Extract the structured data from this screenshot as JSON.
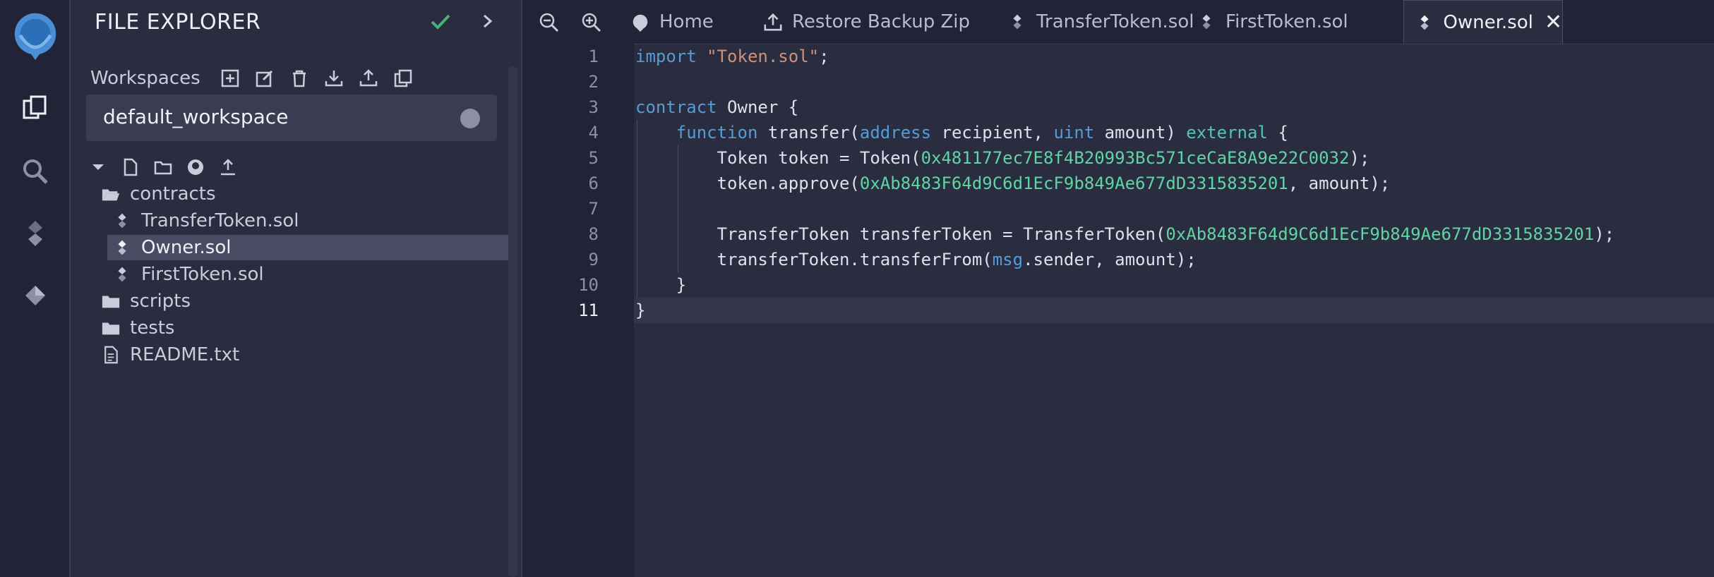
{
  "side_panel": {
    "title": "FILE EXPLORER",
    "workspaces_label": "Workspaces",
    "workspace_selected": "default_workspace",
    "tree": [
      {
        "label": "contracts",
        "type": "folder-open"
      },
      {
        "label": "TransferToken.sol",
        "type": "sol"
      },
      {
        "label": "Owner.sol",
        "type": "sol",
        "selected": true
      },
      {
        "label": "FirstToken.sol",
        "type": "sol"
      },
      {
        "label": "scripts",
        "type": "folder"
      },
      {
        "label": "tests",
        "type": "folder"
      },
      {
        "label": "README.txt",
        "type": "file"
      }
    ]
  },
  "tabs": [
    {
      "label": "Home",
      "icon": "home-icon"
    },
    {
      "label": "Restore Backup Zip",
      "icon": "upload-icon"
    },
    {
      "label": "TransferToken.sol",
      "icon": "solidity-icon"
    },
    {
      "label": "FirstToken.sol",
      "icon": "solidity-icon"
    },
    {
      "label": "Owner.sol",
      "icon": "solidity-icon",
      "active": true
    }
  ],
  "editor": {
    "current_line": 11,
    "lines": [
      {
        "n": "1",
        "parts": [
          [
            "kw",
            "import"
          ],
          [
            "",
            " "
          ],
          [
            "str",
            "\"Token.sol\""
          ],
          [
            "",
            ";"
          ]
        ]
      },
      {
        "n": "2",
        "parts": []
      },
      {
        "n": "3",
        "parts": [
          [
            "kw",
            "contract"
          ],
          [
            "",
            " Owner {"
          ]
        ]
      },
      {
        "n": "4",
        "parts": [
          [
            "",
            "    "
          ],
          [
            "kw",
            "function"
          ],
          [
            "",
            " transfer("
          ],
          [
            "kw",
            "address"
          ],
          [
            "",
            " recipient, "
          ],
          [
            "kw",
            "uint"
          ],
          [
            "",
            " amount) "
          ],
          [
            "kw2",
            "external"
          ],
          [
            "",
            " {"
          ]
        ]
      },
      {
        "n": "5",
        "parts": [
          [
            "",
            "        Token token = Token("
          ],
          [
            "addr",
            "0x481177ec7E8f4B20993Bc571ceCaE8A9e22C0032"
          ],
          [
            "",
            ");"
          ]
        ]
      },
      {
        "n": "6",
        "parts": [
          [
            "",
            "        token.approve("
          ],
          [
            "addr",
            "0xAb8483F64d9C6d1EcF9b849Ae677dD3315835201"
          ],
          [
            "",
            ", amount);"
          ]
        ]
      },
      {
        "n": "7",
        "parts": []
      },
      {
        "n": "8",
        "parts": [
          [
            "",
            "        TransferToken transferToken = TransferToken("
          ],
          [
            "addr",
            "0xAb8483F64d9C6d1EcF9b849Ae677dD3315835201"
          ],
          [
            "",
            ");"
          ]
        ]
      },
      {
        "n": "9",
        "parts": [
          [
            "",
            "        transferToken.transferFrom("
          ],
          [
            "kw",
            "msg"
          ],
          [
            "",
            ".sender, amount);"
          ]
        ]
      },
      {
        "n": "10",
        "parts": [
          [
            "",
            "    }"
          ]
        ]
      },
      {
        "n": "11",
        "parts": [
          [
            "",
            "}"
          ]
        ]
      }
    ]
  },
  "colors": {
    "accent_check": "#4caf74",
    "keyword": "#569cd6",
    "string": "#ce9178",
    "address": "#5fd5a5"
  }
}
